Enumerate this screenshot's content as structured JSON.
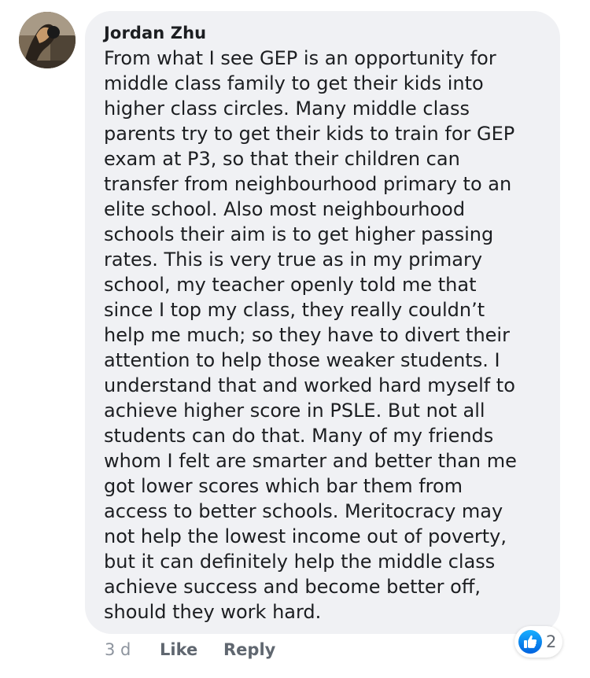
{
  "comment": {
    "author": "Jordan Zhu",
    "text_lines": [
      "From what I see GEP is an opportunity for",
      "middle class family to get their kids into",
      "higher class circles. Many middle class",
      "parents try to get their kids to train for GEP",
      "exam at P3, so that their children can",
      "transfer from neighbourhood primary to an",
      "elite school. Also most neighbourhood",
      "schools their aim is to get higher passing",
      "rates. This is very true as in my primary",
      "school, my teacher openly told me that",
      "since I top my class, they really couldn’t",
      "help me much; so they have to divert their",
      "attention to help those weaker students. I",
      "understand that and worked hard myself to",
      "achieve higher score in PSLE. But not all",
      "students can do that. Many of my friends",
      "whom I felt are smarter and better than me",
      "got lower scores which bar them from",
      "access to better schools. Meritocracy may",
      "not help the lowest income out of poverty,",
      "but it can definitely help the middle class",
      "achieve success and become better off,",
      "should they work hard."
    ],
    "timestamp": "3 d",
    "like_label": "Like",
    "reply_label": "Reply",
    "reaction_count": "2",
    "reaction_icon": "thumbs-up-icon"
  },
  "colors": {
    "bubble_bg": "#f0f1f4",
    "text": "#1c1e21",
    "meta_text": "#606770",
    "timestamp_text": "#8d949e",
    "like_blue": "#1877f2"
  }
}
